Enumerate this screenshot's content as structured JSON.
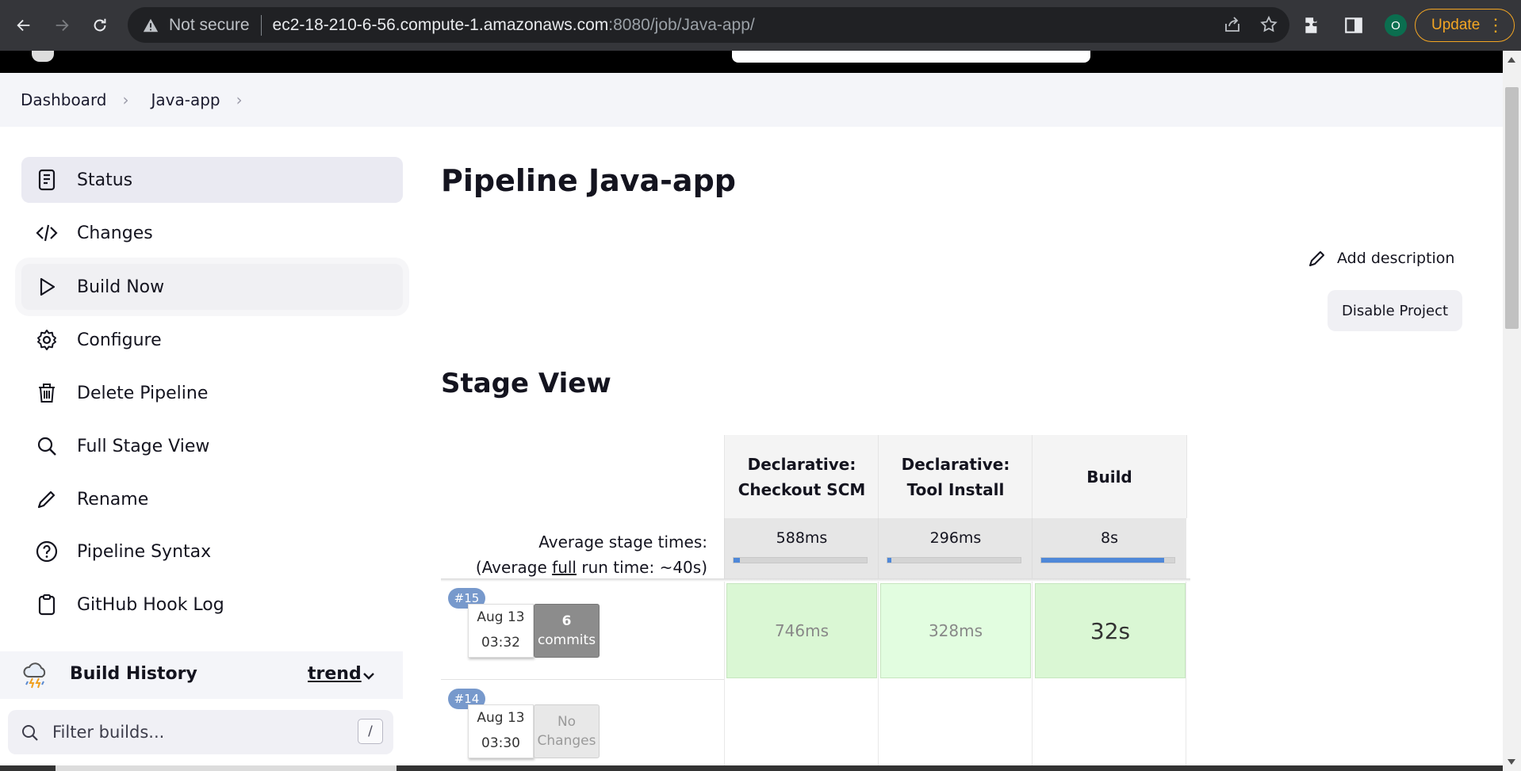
{
  "browser": {
    "not_secure": "Not secure",
    "url_host": "ec2-18-210-6-56.compute-1.amazonaws.com",
    "url_path": ":8080/job/Java-app/",
    "profile_initial": "O",
    "update_label": "Update"
  },
  "breadcrumb": {
    "items": [
      "Dashboard",
      "Java-app"
    ]
  },
  "sidebar": {
    "items": [
      {
        "label": "Status",
        "icon": "document-icon"
      },
      {
        "label": "Changes",
        "icon": "code-icon"
      },
      {
        "label": "Build Now",
        "icon": "play-icon"
      },
      {
        "label": "Configure",
        "icon": "gear-icon"
      },
      {
        "label": "Delete Pipeline",
        "icon": "trash-icon"
      },
      {
        "label": "Full Stage View",
        "icon": "search-icon"
      },
      {
        "label": "Rename",
        "icon": "pencil-icon"
      },
      {
        "label": "Pipeline Syntax",
        "icon": "help-icon"
      },
      {
        "label": "GitHub Hook Log",
        "icon": "clipboard-icon"
      }
    ],
    "build_history": {
      "title": "Build History",
      "trend": "trend"
    },
    "filter": {
      "placeholder": "Filter builds...",
      "shortcut": "/"
    }
  },
  "main": {
    "title": "Pipeline Java-app",
    "add_description": "Add description",
    "disable_project": "Disable Project",
    "stage_view_title": "Stage View"
  },
  "stage_view": {
    "stages": [
      {
        "line1": "Declarative:",
        "line2": "Checkout SCM",
        "avg": "588ms",
        "avg_fraction": 0.05
      },
      {
        "line1": "Declarative:",
        "line2": "Tool Install",
        "avg": "296ms",
        "avg_fraction": 0.03
      },
      {
        "line1": "",
        "line2": "Build",
        "avg": "8s",
        "avg_fraction": 0.92
      }
    ],
    "avg_label_line1": "Average stage times:",
    "avg_label_prefix": "(Average ",
    "avg_label_link": "full",
    "avg_label_suffix": " run time: ~40s)",
    "runs": [
      {
        "id": "#15",
        "date": "Aug 13",
        "time": "03:32",
        "commits_count": "6",
        "commits_label": "commits",
        "durations": [
          "746ms",
          "328ms",
          "32s"
        ]
      },
      {
        "id": "#14",
        "date": "Aug 13",
        "time": "03:30",
        "no_changes_1": "No",
        "no_changes_2": "Changes",
        "durations": []
      }
    ]
  },
  "colors": {
    "success_cell": "#daf7d4",
    "badge": "#7799cc",
    "update": "#f4a623"
  }
}
